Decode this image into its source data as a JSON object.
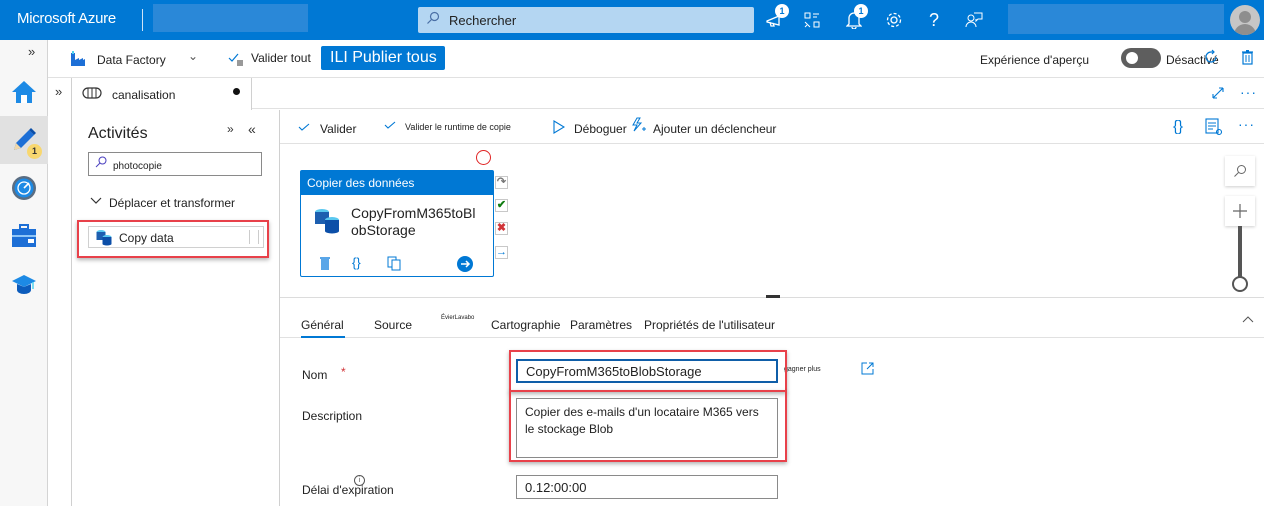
{
  "topbar": {
    "brand": "Microsoft Azure",
    "search_placeholder": "Rechercher",
    "notifications_badge": "1",
    "announcements_badge": "1",
    "icons": [
      "announcement-icon",
      "directory-switch-icon",
      "notification-bell-icon",
      "settings-gear-icon",
      "help-icon",
      "feedback-icon"
    ]
  },
  "rail": {
    "items": [
      {
        "name": "home",
        "icon": "home-icon"
      },
      {
        "name": "author",
        "icon": "pencil-icon",
        "badge": "1",
        "active": true
      },
      {
        "name": "monitor",
        "icon": "monitor-gauge-icon"
      },
      {
        "name": "manage",
        "icon": "toolbox-icon"
      },
      {
        "name": "learning",
        "icon": "graduation-cap-icon"
      }
    ]
  },
  "factory_bar": {
    "factory_label": "Data Factory",
    "validate_all": "Valider tout",
    "publish_all": "ILI  Publier tous",
    "preview_label": "Expérience d'aperçu",
    "preview_state": "Désactivé",
    "preview_on": false
  },
  "pipeline_tab": {
    "label": "canalisation",
    "unsaved": true
  },
  "activities": {
    "title": "Activités",
    "search_value": "photocopie",
    "group_label": "Déplacer et transformer",
    "items": [
      {
        "label": "Copy data",
        "icon": "copy-data-icon"
      }
    ]
  },
  "pipeline_toolbar": {
    "validate": "Valider",
    "validate_runtime": "Valider le runtime de copie",
    "debug": "Déboguer",
    "add_trigger": "Ajouter un déclencheur"
  },
  "canvas": {
    "node": {
      "type_label": "Copier des données",
      "name": "CopyFromM365toBlobStorage"
    }
  },
  "properties": {
    "tabs": [
      {
        "label": "Général",
        "active": true
      },
      {
        "label": "Source"
      },
      {
        "label": "Cartographie",
        "superscript": "ÉvierLavabo"
      },
      {
        "label": "Paramètres"
      },
      {
        "label": "Propriétés de l'utilisateur"
      }
    ],
    "form": {
      "name_label": "Nom",
      "name_required": "*",
      "name_value": "CopyFromM365toBlobStorage",
      "learn_more": "gagner plus",
      "description_label": "Description",
      "description_value": "Copier des e-mails d'un locataire M365 vers le stockage Blob",
      "timeout_label": "Délai d'expiration",
      "timeout_value": "0.12:00:00"
    }
  },
  "colors": {
    "accent": "#0078d4",
    "highlight_box": "#e8414a",
    "success": "#107c10",
    "error": "#d13438"
  }
}
